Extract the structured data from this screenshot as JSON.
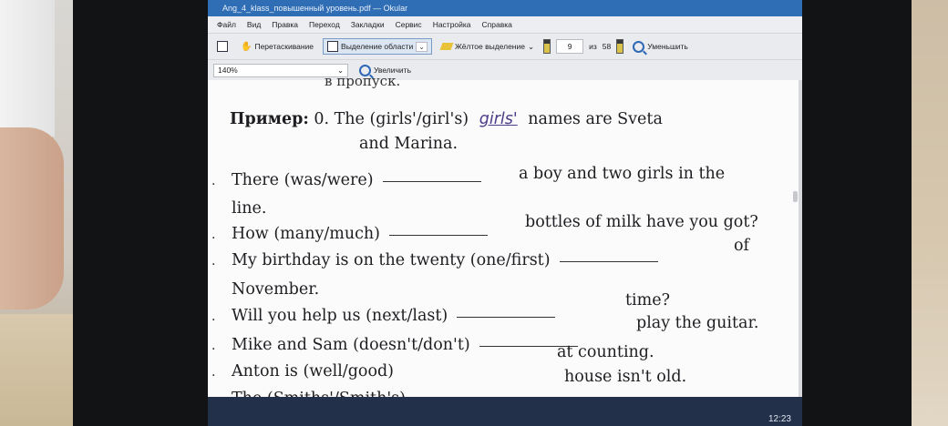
{
  "window": {
    "title": "Ang_4_klass_повышенный уровень.pdf — Okular"
  },
  "menu": [
    "Файл",
    "Вид",
    "Правка",
    "Переход",
    "Закладки",
    "Сервис",
    "Настройка",
    "Справка"
  ],
  "toolbar": {
    "browse_label": "Перетаскивание",
    "select_label": "Выделение области",
    "highlight_label": "Жёлтое выделение",
    "page_value": "9",
    "page_of": "из",
    "page_total": "58",
    "zoom_out_label": "Уменьшить",
    "zoom_value": "140%",
    "zoom_in_label": "Увеличить"
  },
  "document": {
    "clipped_line": "в пропуск.",
    "example_label": "Пример:",
    "example_text_1": "0.  The (girls'/girl's)",
    "example_answer": "girls'",
    "example_text_2": "names are Sveta",
    "example_text_3": "and Marina.",
    "items": [
      {
        "prompt": "There (was/were)",
        "tail": "a boy and two girls in the"
      },
      {
        "prompt": "line.",
        "tail": ""
      },
      {
        "prompt": "How (many/much)",
        "tail": "bottles of milk have you got?"
      },
      {
        "prompt": "My birthday is on the twenty (one/first)",
        "tail": "of"
      },
      {
        "prompt": "November.",
        "tail": ""
      },
      {
        "prompt": "Will you help us (next/last)",
        "tail": "time?"
      },
      {
        "prompt": "Mike and Sam (doesn't/don't)",
        "tail": "play the guitar."
      },
      {
        "prompt": "Anton is (well/good)",
        "tail": "at counting."
      },
      {
        "prompt": "The (Smiths'/Smith's)",
        "tail": "house isn't old."
      }
    ]
  },
  "taskbar": {
    "time": "12:23"
  }
}
